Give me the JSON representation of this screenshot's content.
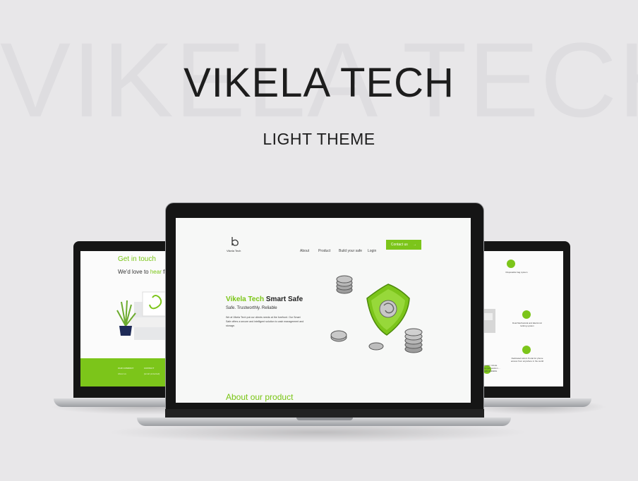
{
  "header": {
    "background_word": "VIKELA TECH",
    "title": "VIKELA TECH",
    "subtitle": "LIGHT THEME"
  },
  "left_screen": {
    "heading": "Get in touch",
    "tagline_start": "We'd love to",
    "tagline_highlight": "hear",
    "tagline_end": "fro",
    "footer_col1_title": "OUR COMPANY",
    "footer_col1_item": "About us",
    "footer_col2_title": "CONTACT",
    "footer_col2_item": "[email protected]"
  },
  "center_screen": {
    "logo_text": "Vikela Tech",
    "nav": {
      "about": "About",
      "product": "Product",
      "build": "Build your safe",
      "login": "Login",
      "contact": "Contact us",
      "contact_arrow": "→"
    },
    "hero": {
      "title_green": "Vikela Tech",
      "title_rest": "Smart Safe",
      "tagline": "Safe. Trustworthly. Reliable",
      "body": "We at Vikela Tech put our clients needs at the forefront. Our Smart Safe offers a secure and intelligent solution to cash management and storage."
    },
    "about_heading": "About our product"
  },
  "right_screen": {
    "feature1": "Disposable bag system",
    "feature2": "Dual Mechanical and Electronic locking system",
    "feature3": "Dedicated Admin Portal for phone access from anywhere in the world",
    "feature4": "notes per minute notes per session ... speeds available"
  },
  "colors": {
    "accent": "#7cc51a",
    "background": "#e8e7e9",
    "bezel": "#151515"
  }
}
